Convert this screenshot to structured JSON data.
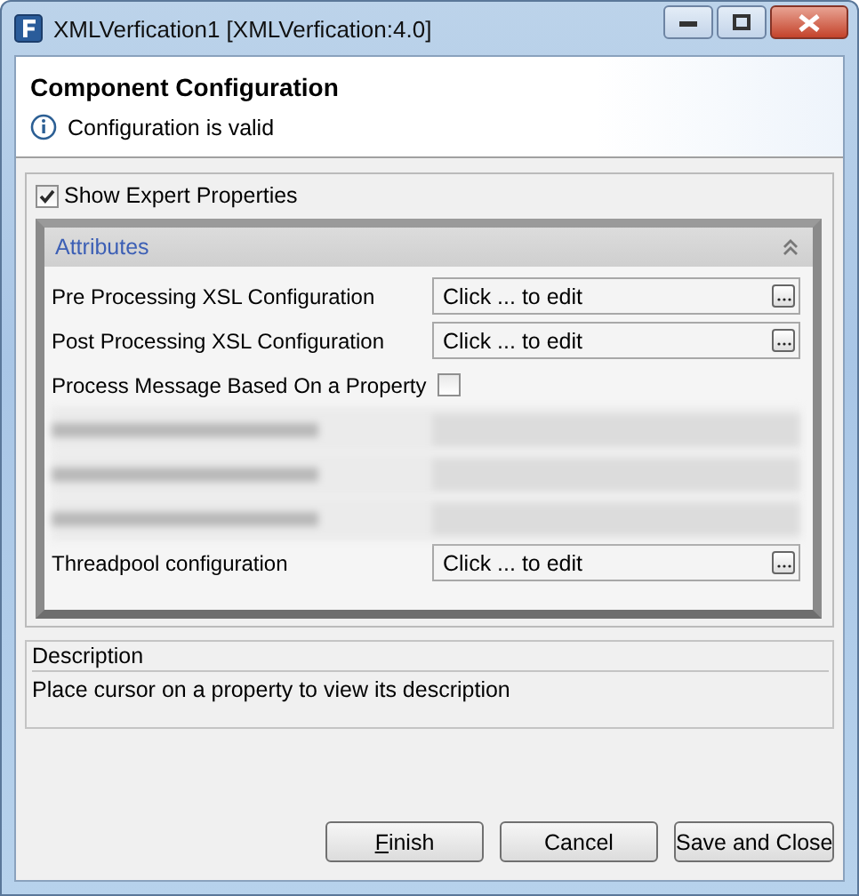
{
  "window": {
    "title": "XMLVerfication1 [XMLVerfication:4.0]"
  },
  "header": {
    "title": "Component Configuration",
    "status": "Configuration is valid"
  },
  "expert": {
    "label": "Show Expert Properties",
    "checked": true
  },
  "section": {
    "title": "Attributes",
    "expanded": true,
    "rows": [
      {
        "kind": "editor",
        "label": "Pre Processing XSL Configuration",
        "value": "Click ... to edit"
      },
      {
        "kind": "editor",
        "label": "Post Processing XSL Configuration",
        "value": "Click ... to edit"
      },
      {
        "kind": "checkbox",
        "label": "Process Message Based On a Property",
        "checked": false
      },
      {
        "kind": "blurred"
      },
      {
        "kind": "blurred"
      },
      {
        "kind": "blurred"
      },
      {
        "kind": "editor",
        "label": "Threadpool configuration",
        "value": "Click ... to edit"
      }
    ]
  },
  "description": {
    "title": "Description",
    "text": "Place cursor on a property to view its description"
  },
  "buttons": [
    {
      "label": "Finish",
      "mnemonic_first": true
    },
    {
      "label": "Cancel",
      "mnemonic_first": false
    },
    {
      "label": "Save and Close",
      "mnemonic_first": false
    }
  ]
}
